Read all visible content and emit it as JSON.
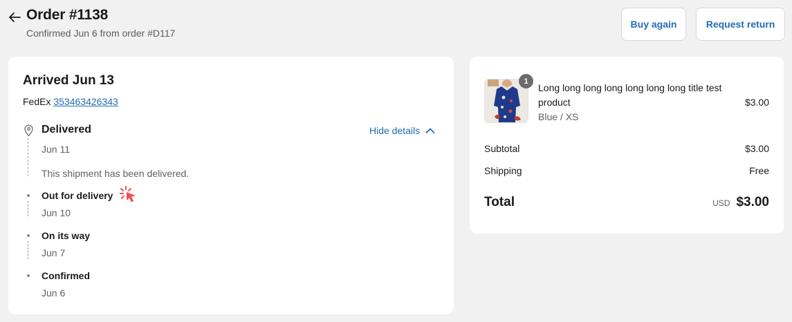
{
  "header": {
    "title": "Order #1138",
    "subtitle": "Confirmed Jun 6 from order #D117",
    "buy_again_label": "Buy again",
    "request_return_label": "Request return"
  },
  "shipment": {
    "heading": "Arrived Jun 13",
    "carrier": "FedEx",
    "tracking_number": "353463426343",
    "hide_details_label": "Hide details",
    "timeline": [
      {
        "status": "Delivered",
        "date": "Jun 11",
        "note": "This shipment has been delivered."
      },
      {
        "status": "Out for delivery",
        "date": "Jun 10"
      },
      {
        "status": "On its way",
        "date": "Jun 7"
      },
      {
        "status": "Confirmed",
        "date": "Jun 6"
      }
    ]
  },
  "summary": {
    "product": {
      "title": "Long long long long long long long title test product",
      "variant": "Blue / XS",
      "price": "$3.00",
      "quantity": "1"
    },
    "subtotal_label": "Subtotal",
    "subtotal_value": "$3.00",
    "shipping_label": "Shipping",
    "shipping_value": "Free",
    "total_label": "Total",
    "currency": "USD",
    "total_value": "$3.00"
  },
  "icons": {
    "back": "arrow-left-icon",
    "location": "map-pin-icon",
    "chevron": "chevron-up-icon",
    "cursor": "click-cursor-icon"
  },
  "colors": {
    "accent": "#1f6db5",
    "background": "#f1f1f1",
    "cursor": "#f0504a"
  }
}
